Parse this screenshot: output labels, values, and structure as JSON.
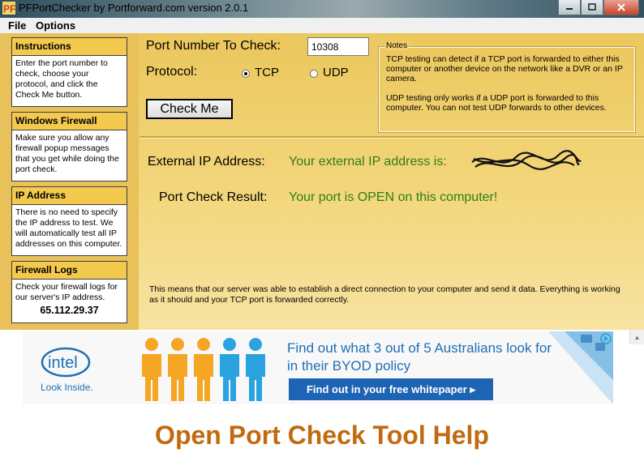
{
  "window": {
    "title": "PFPortChecker by Portforward.com version 2.0.1"
  },
  "menu": {
    "file": "File",
    "options": "Options"
  },
  "sidebar": {
    "instructions": {
      "title": "Instructions",
      "text": "Enter the port number to check, choose your protocol, and click the Check Me button."
    },
    "firewall": {
      "title": "Windows Firewall",
      "text": "Make sure you allow any firewall popup messages that you get while doing the port check."
    },
    "ip": {
      "title": "IP Address",
      "text": "There is no need to specify the IP address to test. We will automatically test all IP addresses on this computer."
    },
    "logs": {
      "title": "Firewall Logs",
      "text": "Check your firewall logs for our server's IP address.",
      "server_ip": "65.112.29.37"
    }
  },
  "form": {
    "port_label": "Port Number To Check:",
    "port_value": "10308",
    "protocol_label": "Protocol:",
    "tcp_label": "TCP",
    "udp_label": "UDP",
    "selected_protocol": "TCP",
    "check_button": "Check Me"
  },
  "notes": {
    "legend": "Notes",
    "tcp": "TCP testing can detect if a TCP port is forwarded to either this computer or another device on the network like a DVR or an IP camera.",
    "udp": "UDP testing only works if a UDP port is forwarded to this computer. You can not test UDP forwards to other devices."
  },
  "results": {
    "external_ip_label": "External IP Address:",
    "external_ip_value": "Your external IP address is:",
    "result_label": "Port Check Result:",
    "result_value": "Your port is OPEN on this computer!",
    "explanation": "This means that our server was able to establish a direct connection to your computer and send it data. Everything is working as it should and your TCP port is forwarded correctly."
  },
  "ad": {
    "brand": "intel",
    "tagline": "Look Inside.",
    "headline": "Find out what 3 out of 5 Australians look for in their BYOD policy",
    "cta": "Find out in your free whitepaper ▸"
  },
  "help": {
    "title": "Open Port Check Tool Help"
  },
  "colors": {
    "result_green": "#2e7d18",
    "help_orange": "#c26a10",
    "intel_blue": "#1f6fb5"
  }
}
